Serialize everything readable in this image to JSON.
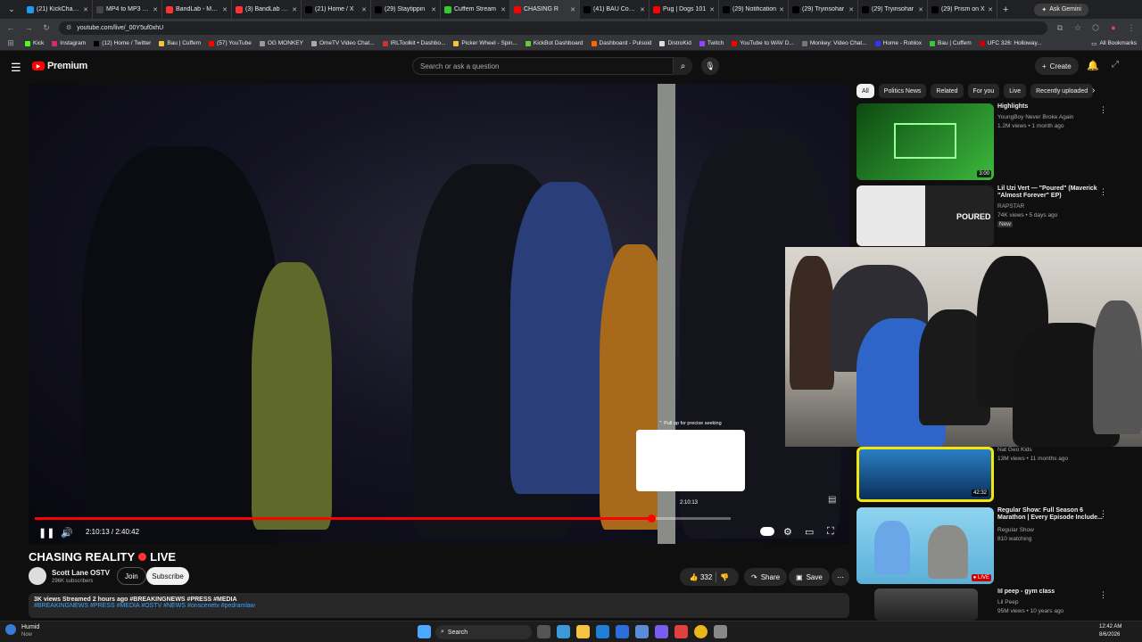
{
  "browser": {
    "tabs": [
      {
        "label": "(21) KickChamp",
        "color": "#1d9bf0"
      },
      {
        "label": "MP4 to MP3 | C",
        "color": "#444"
      },
      {
        "label": "BandLab - Make",
        "color": "#f33"
      },
      {
        "label": "(3) BandLab - M",
        "color": "#f33"
      },
      {
        "label": "(21) Home / X",
        "color": "#000"
      },
      {
        "label": "(29) Staytippin",
        "color": "#000"
      },
      {
        "label": "Cuffem Stream",
        "color": "#3c3"
      },
      {
        "label": "CHASING R",
        "color": "#f00"
      },
      {
        "label": "(41) BAU Comm",
        "color": "#000"
      },
      {
        "label": "Pug | Dogs 101",
        "color": "#f00"
      },
      {
        "label": "(29) Notification",
        "color": "#000"
      },
      {
        "label": "(29) Tryinsohar",
        "color": "#000"
      },
      {
        "label": "(29) Tryinsohar",
        "color": "#000"
      },
      {
        "label": "(29) Prism on X",
        "color": "#000"
      }
    ],
    "active_tab_index": 7,
    "ask_gemini": "Ask Gemini",
    "url": "youtube.com/live/_00Y5uf0xhU",
    "bookmarks": [
      "Kick",
      "Instagram",
      "(12) Home / Twitter",
      "Bau | Cuffem",
      "(57) YouTube",
      "OG MONKEY",
      "OmeTV Video Chat...",
      "IRLToolkit • Dashbo...",
      "Picker Wheel - Spin...",
      "KickBot Dashboard",
      "Dashboard - Pulsoid",
      "DistroKid",
      "Twitch",
      "YouTube to WAV D...",
      "Monkey: Video Chat...",
      "Home - Roblox",
      "Bau | Cuffem",
      "UFC 326: Holloway..."
    ],
    "all_bookmarks": "All Bookmarks"
  },
  "header": {
    "logo": "Premium",
    "search_placeholder": "Search or ask a question",
    "create": "Create"
  },
  "player": {
    "time": "2:10:13 / 2:40:42",
    "hover_time": "2:10:13",
    "hint": "Pull up for precise seeking",
    "progress": 0.942,
    "buffered": 1.0
  },
  "video_info": {
    "title": "CHASING REALITY",
    "live_label": "LIVE",
    "channel": "Scott Lane OSTV",
    "subscribers": "296K subscribers",
    "join": "Join",
    "subscribe": "Subscribe",
    "likes": "332",
    "share": "Share",
    "save": "Save",
    "desc_meta": "3K views  Streamed 2 hours ago  #BREAKINGNEWS #PRESS #MEDIA",
    "desc_tags": "#BREAKINGNEWS #PRESS #MEDIA #OSTV #NEWS #onscenetv #pedramlaw"
  },
  "sidebar": {
    "chips": [
      "All",
      "Politics News",
      "Related",
      "For you",
      "Live",
      "Recently uploaded"
    ],
    "recs": [
      {
        "title": "Highlights",
        "channel": "YoungBoy Never Broke Again",
        "meta": "1.2M views • 1 month ago",
        "duration": "3:00"
      },
      {
        "title": "Lil Uzi Vert — \"Poured\" (Maverick \"Almost Forever\" EP)",
        "channel": "RAPSTAR",
        "meta": "74K views • 5 days ago",
        "badge": "New"
      },
      {
        "title": "",
        "channel": "Nat Geo Kids",
        "meta": "13M views • 11 months ago",
        "duration": "42:32"
      },
      {
        "title": "Regular Show: Full Season 6 Marathon | Every Episode Include...",
        "channel": "Regular Show",
        "meta": "810 watching",
        "duration": "LIVE"
      },
      {
        "title": "lil peep - gym class",
        "channel": "Lil Peep",
        "meta": "95M views • 10 years ago"
      }
    ]
  },
  "taskbar": {
    "weather_title": "Humid",
    "weather_sub": "Now",
    "search": "Search",
    "time": "12:42 AM",
    "date": "8/6/2026"
  }
}
